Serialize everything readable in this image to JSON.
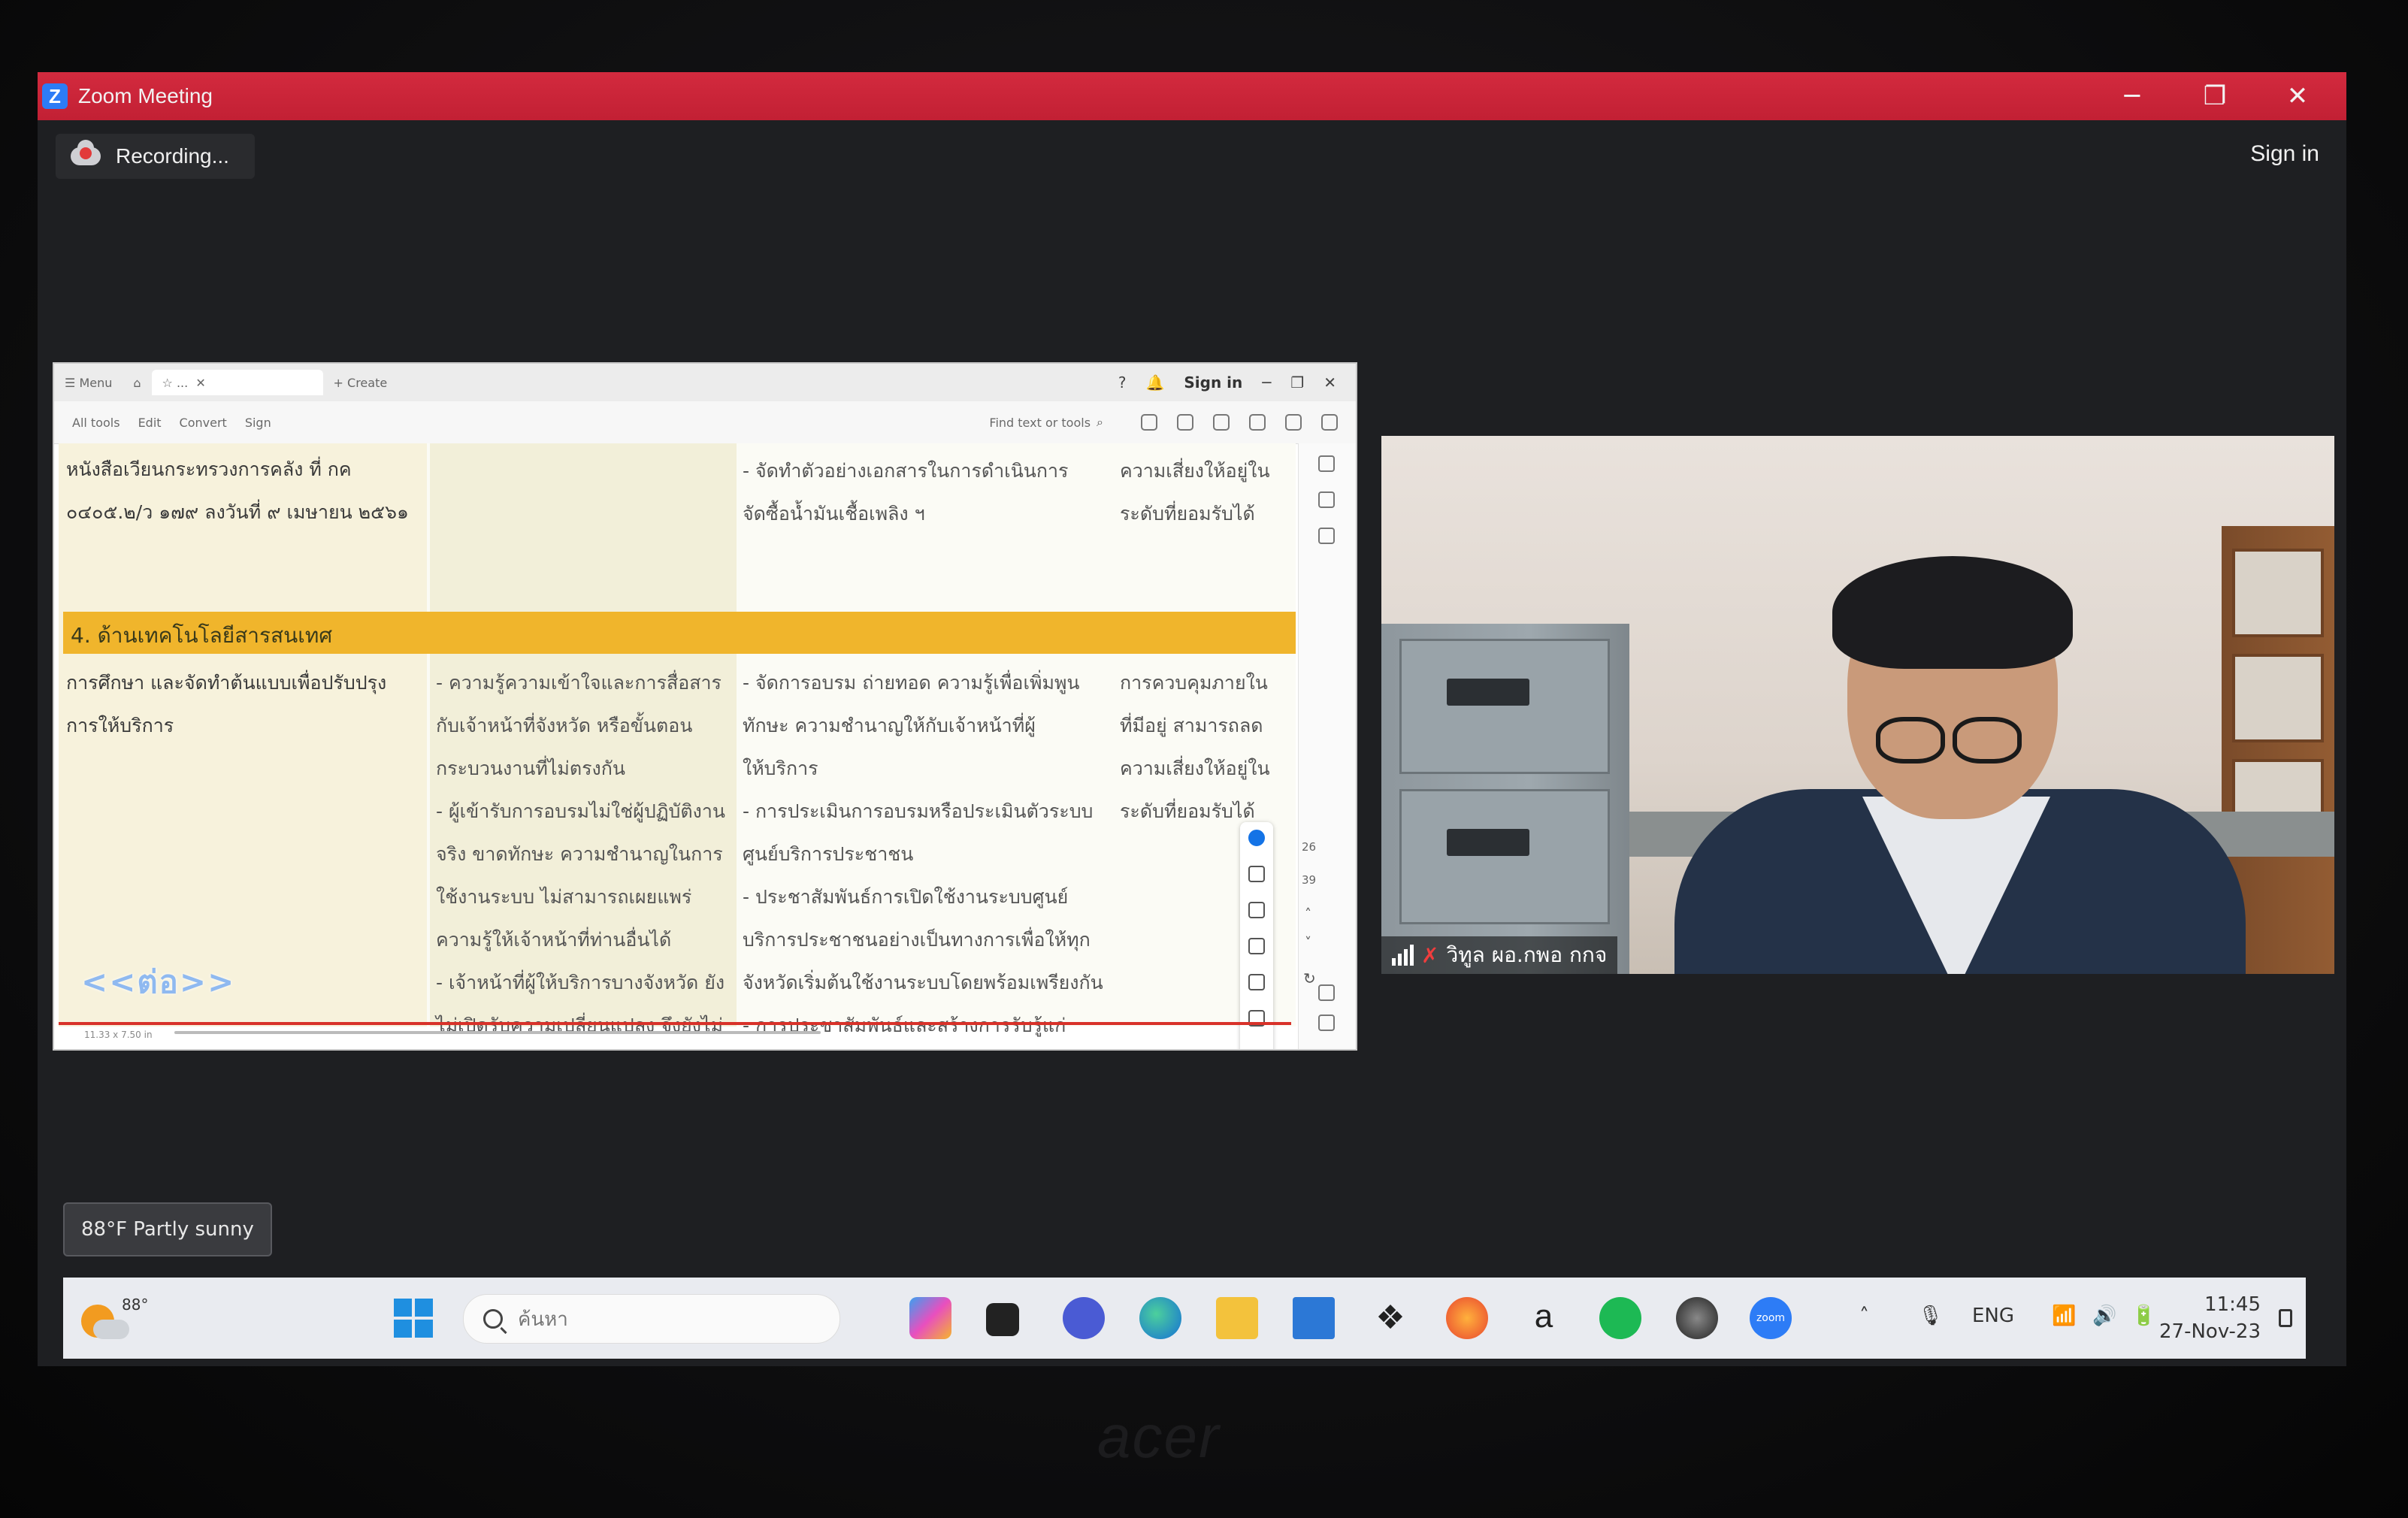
{
  "window": {
    "title": "Zoom Meeting",
    "sign_in": "Sign in",
    "recording": "Recording..."
  },
  "pdf": {
    "tabs": [
      "Menu",
      "...",
      "Create"
    ],
    "sign_in": "Sign in",
    "tools": [
      "All tools",
      "Edit",
      "Convert",
      "Sign"
    ],
    "find_placeholder": "Find text or tools",
    "page_numbers": [
      "26",
      "39"
    ],
    "status": "11.33 x 7.50 in",
    "section_header": "4. ด้านเทคโนโลยีสารสนเทศ",
    "row_top": {
      "c0": "หนังสือเวียนกระทรวงการคลัง ที่ กค\n๐๔๐๕.๒/ว ๑๗๙ ลงวันที่ ๙ เมษายน ๒๕๖๑",
      "c2": "- จัดทำตัวอย่างเอกสารในการดำเนินการ\nจัดซื้อน้ำมันเชื้อเพลิง ฯ",
      "c3": "ความเสี่ยงให้อยู่ใน\nระดับที่ยอมรับได้"
    },
    "row_main": {
      "c0": "การศึกษา และจัดทำต้นแบบเพื่อปรับปรุง\nการให้บริการ",
      "c1": "- ความรู้ความเข้าใจและการสื่อสาร\nกับเจ้าหน้าที่จังหวัด หรือขั้นตอน\nกระบวนงานที่ไม่ตรงกัน\n- ผู้เข้ารับการอบรมไม่ใช่ผู้ปฏิบัติงาน\nจริง ขาดทักษะ ความชำนาญในการ\nใช้งานระบบ ไม่สามารถเผยแพร่\nความรู้ให้เจ้าหน้าที่ท่านอื่นได้\n- เจ้าหน้าที่ผู้ให้บริการบางจังหวัด ยัง\nไม่เปิดรับความเปลี่ยนแปลง จึงยังไม่\nเริ่มใช้งานระบบ",
      "c2": "- จัดการอบรม ถ่ายทอด ความรู้เพื่อเพิ่มพูน\nทักษะ ความชำนาญให้กับเจ้าหน้าที่ผู้\nให้บริการ\n- การประเมินการอบรมหรือประเมินตัวระบบ\nศูนย์บริการประชาชน\n- ประชาสัมพันธ์การเปิดใช้งานระบบศูนย์\nบริการประชาชนอย่างเป็นทางการเพื่อให้ทุก\nจังหวัดเริ่มต้นใช้งานระบบโดยพร้อมเพรียงกัน\n- การประชาสัมพันธ์และสร้างการรับรู้แก่\nประชาชนในการยื่นคำร้องออนไลน์",
      "c3": "การควบคุมภายใน\nที่มีอยู่ สามารถลด\nความเสี่ยงให้อยู่ใน\nระดับที่ยอมรับได้"
    },
    "continue_label": "<<ต่อ>>"
  },
  "video": {
    "participant_name": "วิทูล ผอ.กพอ กกจ"
  },
  "weather_widget": "88°F Partly sunny",
  "taskbar": {
    "temp": "88°",
    "search_placeholder": "ค้นหา",
    "lang": "ENG",
    "time": "11:45",
    "date": "27-Nov-23"
  },
  "brand": "acer",
  "colors": {
    "zoom_titlebar": "#c22034",
    "pdf_header": "#f0b52c",
    "accent": "#1473e6"
  }
}
